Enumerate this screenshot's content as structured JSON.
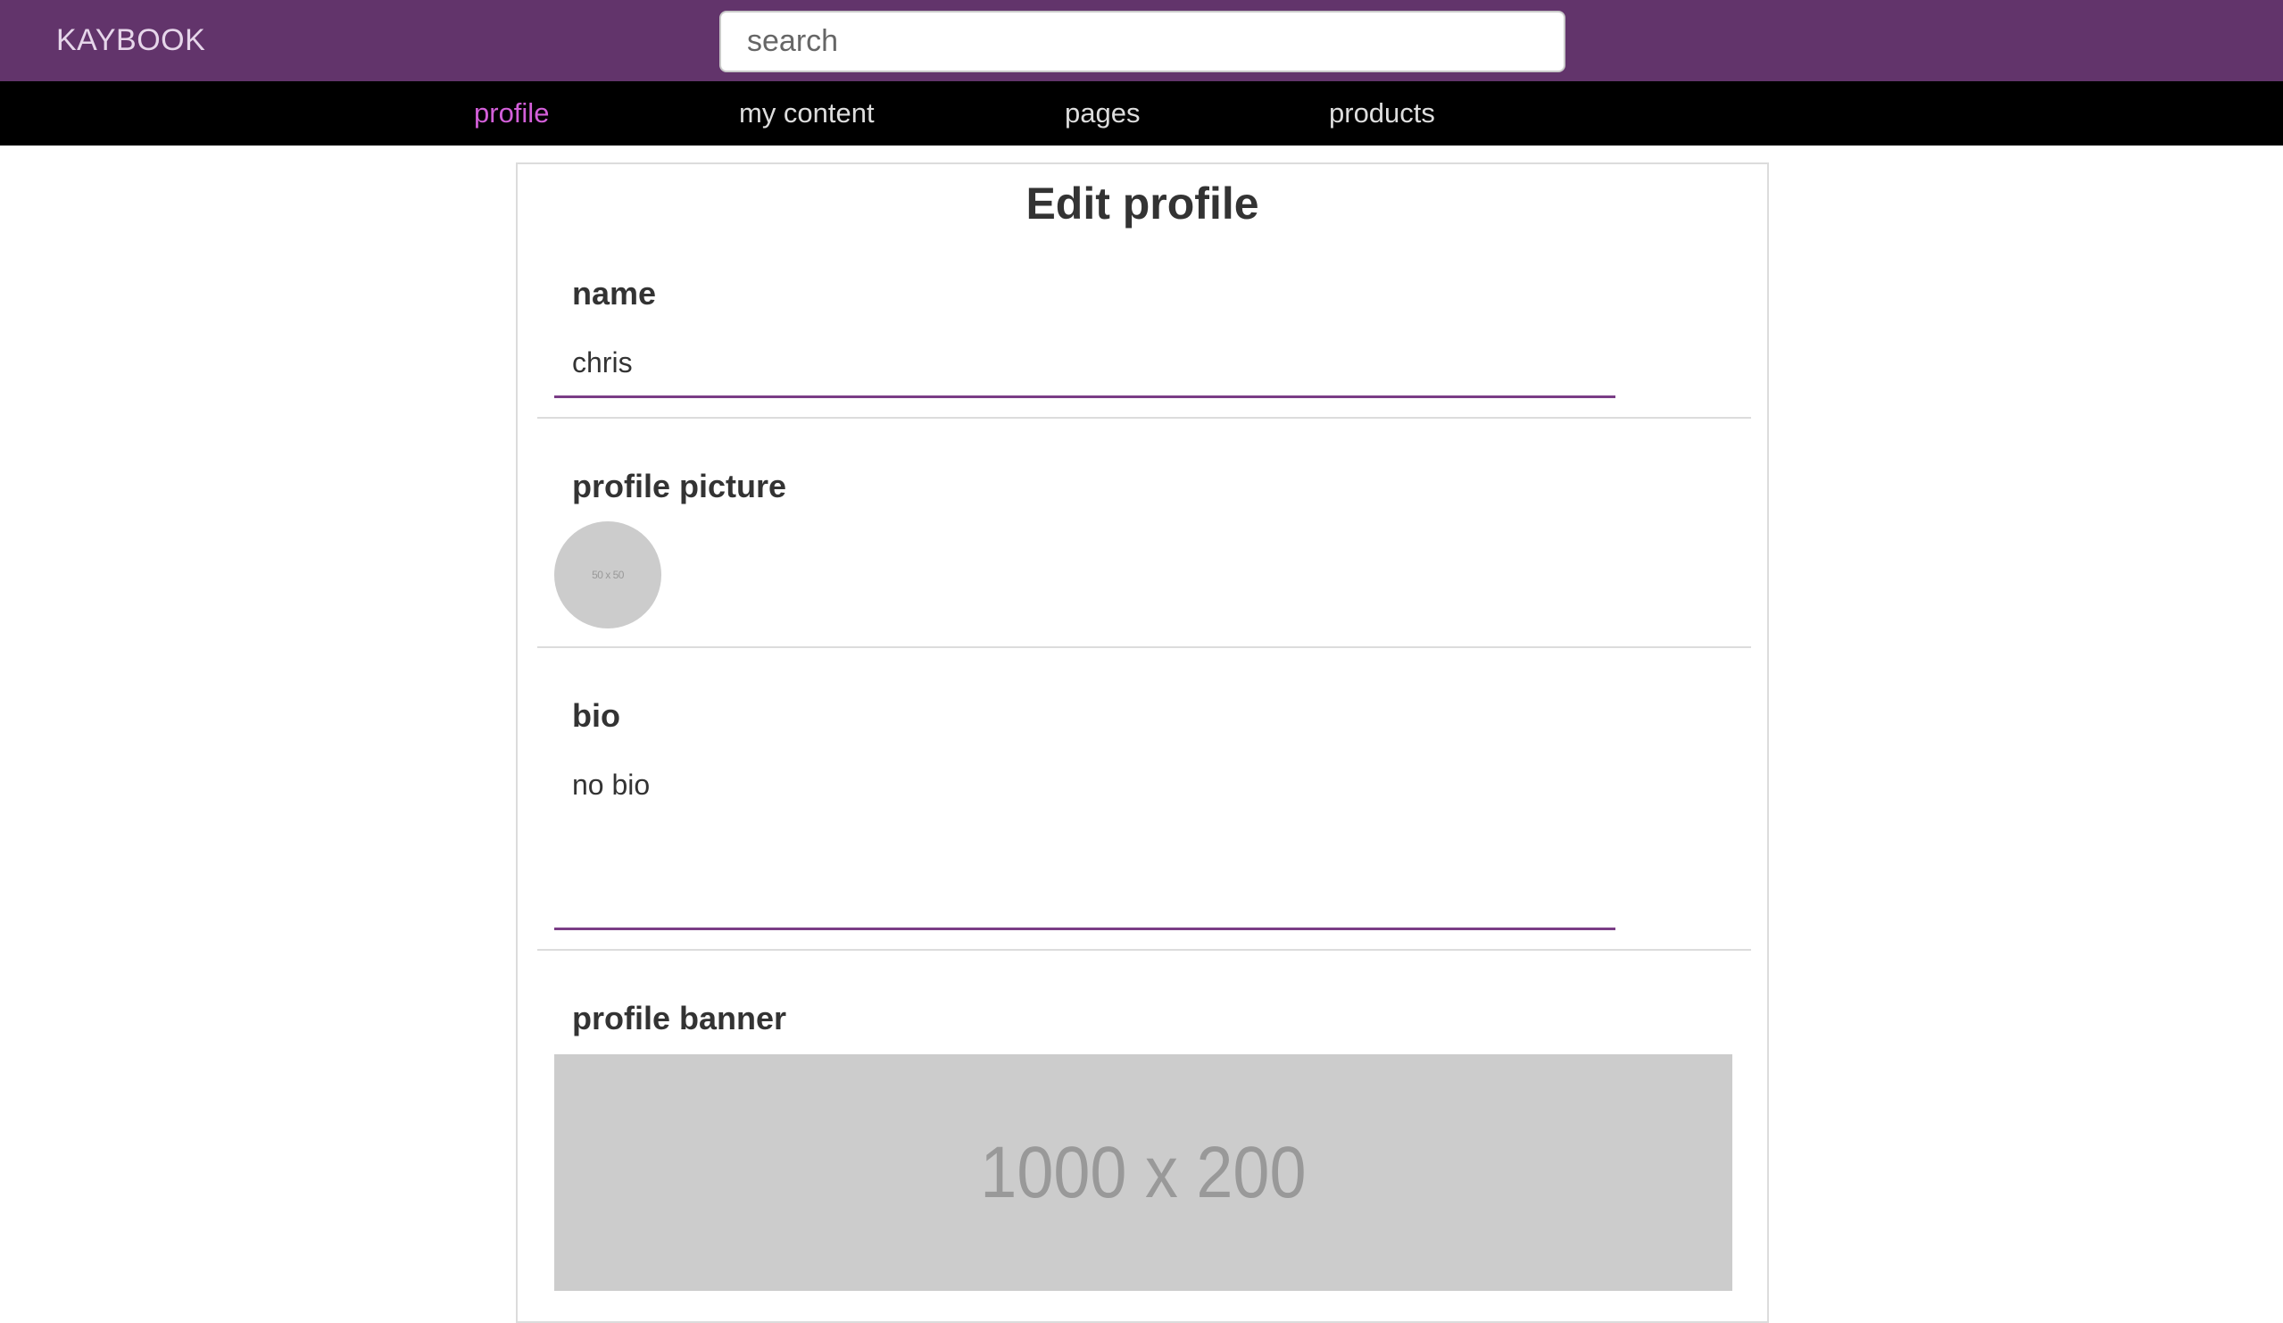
{
  "header": {
    "brand": "KAYBOOK",
    "search_placeholder": "search"
  },
  "nav": {
    "items": [
      {
        "label": "profile",
        "active": true
      },
      {
        "label": "my content",
        "active": false
      },
      {
        "label": "pages",
        "active": false
      },
      {
        "label": "products",
        "active": false
      }
    ]
  },
  "form": {
    "title": "Edit profile",
    "name": {
      "label": "name",
      "value": "chris"
    },
    "picture": {
      "label": "profile picture",
      "placeholder_text": "50 x 50"
    },
    "bio": {
      "label": "bio",
      "value": "no bio"
    },
    "banner": {
      "label": "profile banner",
      "placeholder_text": "1000 x 200"
    }
  },
  "colors": {
    "header_bg": "#62346b",
    "nav_bg": "#000000",
    "active_nav": "#d35fd9",
    "field_underline": "#7a3d86"
  }
}
